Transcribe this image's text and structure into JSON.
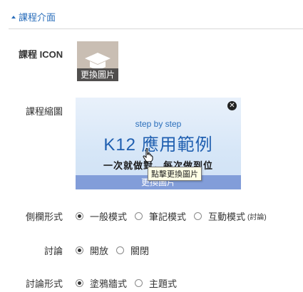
{
  "section": {
    "title": "課程介面"
  },
  "icon_row": {
    "label": "課程 ICON",
    "change_label": "更換圖片"
  },
  "thumb_row": {
    "label": "課程縮圖",
    "step_text": "step by step",
    "big_text": "K12 應用範例",
    "tagline": "一次就做對，每次做到位",
    "change_label": "更換圖片",
    "close_glyph": "✕",
    "tooltip": "點擊更換圖片"
  },
  "sidebar_row": {
    "label": "側欄形式",
    "options": [
      {
        "label": "一般模式",
        "checked": true
      },
      {
        "label": "筆記模式",
        "checked": false
      },
      {
        "label": "互動模式",
        "note": "(討論)",
        "checked": false
      }
    ]
  },
  "discussion_row": {
    "label": "討論",
    "options": [
      {
        "label": "開放",
        "checked": true
      },
      {
        "label": "關閉",
        "checked": false
      }
    ]
  },
  "discussion_style_row": {
    "label": "討論形式",
    "options": [
      {
        "label": "塗鴉牆式",
        "checked": true
      },
      {
        "label": "主題式",
        "checked": false
      }
    ]
  }
}
